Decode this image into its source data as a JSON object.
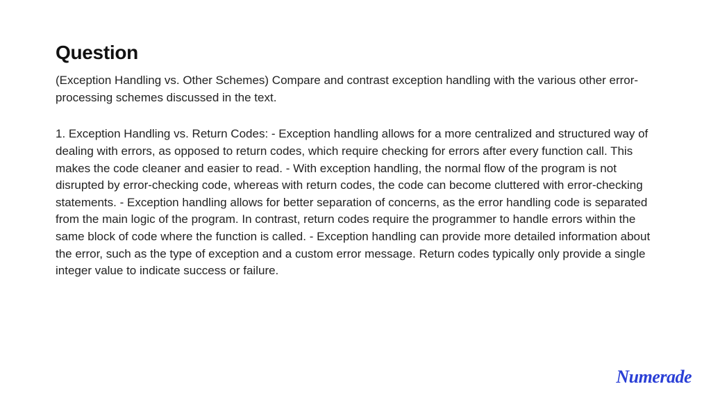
{
  "heading": "Question",
  "question": "(Exception Handling vs. Other Schemes) Compare and contrast exception handling with the various other error-processing schemes discussed in the text.",
  "answer": "1. Exception Handling vs. Return Codes: - Exception handling allows for a more centralized and structured way of dealing with errors, as opposed to return codes, which require checking for errors after every function call. This makes the code cleaner and easier to read. - With exception handling, the normal flow of the program is not disrupted by error-checking code, whereas with return codes, the code can become cluttered with error-checking statements. - Exception handling allows for better separation of concerns, as the error handling code is separated from the main logic of the program. In contrast, return codes require the programmer to handle errors within the same block of code where the function is called. - Exception handling can provide more detailed information about the error, such as the type of exception and a custom error message. Return codes typically only provide a single integer value to indicate success or failure.",
  "brand": "Numerade"
}
